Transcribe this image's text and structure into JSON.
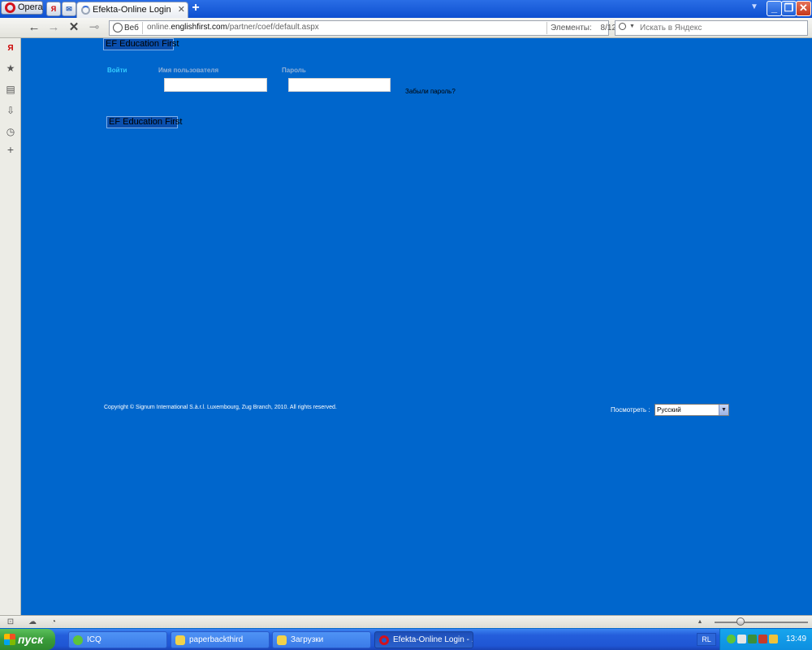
{
  "browser": {
    "menu_label": "Opera",
    "active_tab_title": "Efekta-Online Login",
    "address": {
      "web_badge": "Веб",
      "url_prefix": "online.",
      "url_domain": "englishfirst.com",
      "url_path": "/partner/coef/default.aspx",
      "elements_label": "Элементы:",
      "elements_count": "8/12"
    },
    "search_placeholder": "Искать в Яндекс"
  },
  "page": {
    "logo_text": "EF Education First",
    "login_link": "Войти",
    "username_label": "Имя пользователя",
    "password_label": "Пароль",
    "forgot_password": "Забыли пароль?",
    "copyright": "Copyright © Signum International S.à.r.l. Luxembourg, Zug Branch, 2010. All rights reserved.",
    "view_label": "Посмотреть :",
    "language_selected": "Русский"
  },
  "taskbar": {
    "start_label": "пуск",
    "tasks": [
      {
        "label": "ICQ"
      },
      {
        "label": "paperbackthird"
      },
      {
        "label": "Загрузки"
      },
      {
        "label": "Efekta-Online Login - ..."
      }
    ],
    "language_indicator": "RL",
    "clock": "13:49"
  },
  "colors": {
    "page_background": "#0066cc",
    "login_link": "#33ccff",
    "taskbar": "#245edb",
    "start_button": "#3a9c3a"
  }
}
